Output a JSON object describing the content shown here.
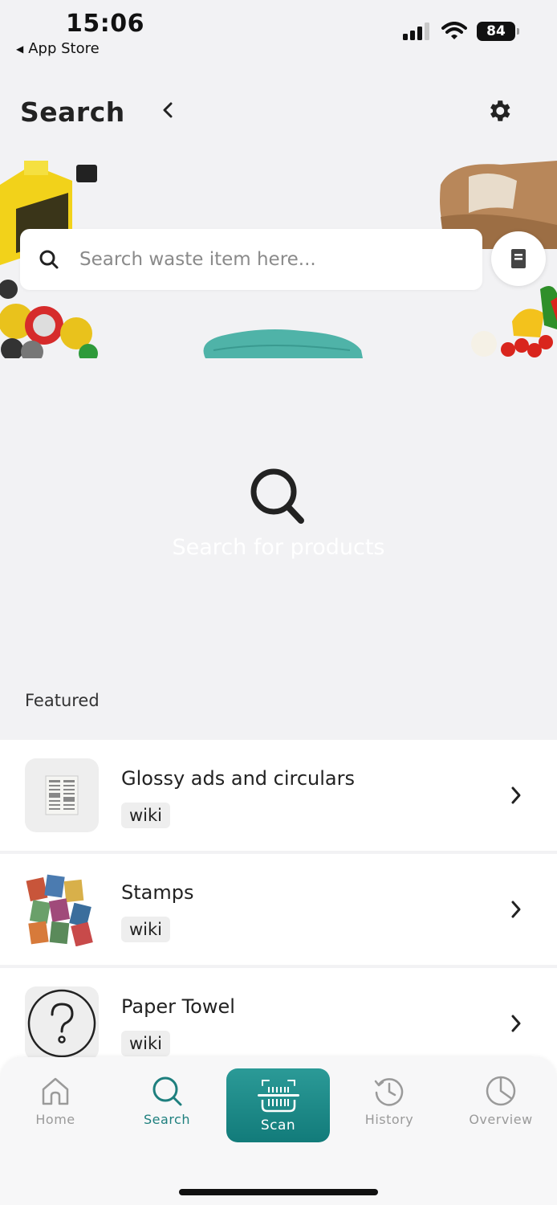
{
  "status_bar": {
    "time": "15:06",
    "back_app": "App Store",
    "battery": "84"
  },
  "header": {
    "title": "Search",
    "back_icon": "chevron-left-icon",
    "settings_icon": "gear-icon"
  },
  "search": {
    "placeholder": "Search waste item here...",
    "value": ""
  },
  "empty_state": {
    "text": "Search for products"
  },
  "featured": {
    "label": "Featured",
    "items": [
      {
        "title": "Glossy ads and circulars",
        "tag": "wiki"
      },
      {
        "title": "Stamps",
        "tag": "wiki"
      },
      {
        "title": "Paper Towel",
        "tag": "wiki"
      }
    ]
  },
  "tab_bar": {
    "home": "Home",
    "search": "Search",
    "scan": "Scan",
    "history": "History",
    "overview": "Overview",
    "active": "Search"
  },
  "colors": {
    "accent": "#1e7f7e",
    "background": "#f2f2f4",
    "inactive_tab": "#9a9a9a"
  }
}
